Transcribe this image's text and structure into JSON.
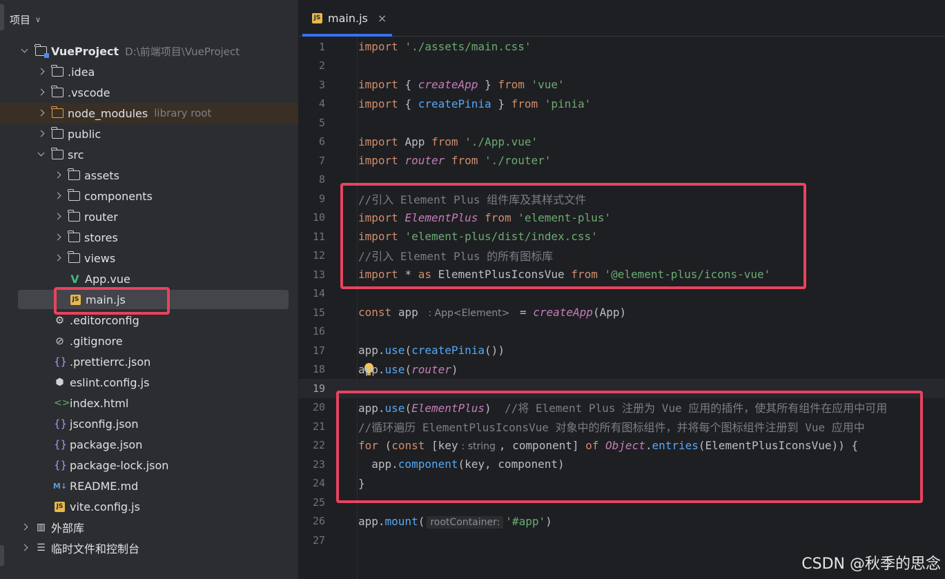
{
  "sidebar": {
    "header": {
      "title": "项目"
    },
    "project": {
      "name": "VueProject",
      "path": "D:\\前端项目\\VueProject"
    },
    "tree": [
      {
        "label": ".idea"
      },
      {
        "label": ".vscode"
      },
      {
        "label": "node_modules",
        "hint": "library root"
      },
      {
        "label": "public"
      },
      {
        "label": "src"
      },
      {
        "label": "assets"
      },
      {
        "label": "components"
      },
      {
        "label": "router"
      },
      {
        "label": "stores"
      },
      {
        "label": "views"
      },
      {
        "label": "App.vue"
      },
      {
        "label": "main.js"
      },
      {
        "label": ".editorconfig"
      },
      {
        "label": ".gitignore"
      },
      {
        "label": ".prettierrc.json"
      },
      {
        "label": "eslint.config.js"
      },
      {
        "label": "index.html"
      },
      {
        "label": "jsconfig.json"
      },
      {
        "label": "package.json"
      },
      {
        "label": "package-lock.json"
      },
      {
        "label": "README.md"
      },
      {
        "label": "vite.config.js"
      },
      {
        "label": "外部库"
      },
      {
        "label": "临时文件和控制台"
      }
    ],
    "icons": {
      "js_badge": "JS",
      "md_badge": "M↓"
    }
  },
  "editor": {
    "tab": {
      "label": "main.js",
      "close": "×"
    },
    "current_line": 19,
    "lines": {
      "l1": {
        "kw1": "import",
        "s1": "'./assets/main.css'"
      },
      "l3": {
        "kw1": "import",
        "p1": "{",
        "f1": "createApp",
        "p2": "}",
        "kw2": "from",
        "s1": "'vue'"
      },
      "l4": {
        "kw1": "import",
        "p1": "{",
        "f1": "createPinia",
        "p2": "}",
        "kw2": "from",
        "s1": "'pinia'"
      },
      "l6": {
        "kw1": "import",
        "t1": "App",
        "kw2": "from",
        "s1": "'./App.vue'"
      },
      "l7": {
        "kw1": "import",
        "f1": "router",
        "kw2": "from",
        "s1": "'./router'"
      },
      "l9": {
        "c1": "//引入 Element Plus 组件库及其样式文件"
      },
      "l10": {
        "kw1": "import",
        "f1": "ElementPlus",
        "kw2": "from",
        "s1": "'element-plus'"
      },
      "l11": {
        "kw1": "import",
        "s1": "'element-plus/dist/index.css'"
      },
      "l12": {
        "c1": "//引入 Element Plus 的所有图标库"
      },
      "l13": {
        "kw1": "import",
        "t1": "*",
        "kw2": "as",
        "t2": "ElementPlusIconsVue",
        "kw3": "from",
        "s1": "'@element-plus/icons-vue'"
      },
      "l15": {
        "kw1": "const",
        "t1": "app",
        "h1": ": App<Element>",
        "t2": "=",
        "f1": "createApp",
        "t3": "(App)"
      },
      "l17": {
        "t1": "app.",
        "f1": "use",
        "t2": "(",
        "f2": "createPinia",
        "t3": "())"
      },
      "l18": {
        "t1": "app.",
        "f1": "use",
        "t2": "(",
        "f2": "router",
        "t3": ")"
      },
      "l20": {
        "t1": "app.",
        "f1": "use",
        "t2": "(",
        "f2": "ElementPlus",
        "t3": ")",
        "c1": "//将 Element Plus 注册为 Vue 应用的插件，使其所有组件在应用中可用"
      },
      "l21": {
        "c1": "//循环遍历 ElementPlusIconsVue 对象中的所有图标组件，并将每个图标组件注册到 Vue 应用中"
      },
      "l22": {
        "kw1": "for",
        "t1": "(",
        "kw2": "const",
        "t2": "[key",
        "h1": ": string",
        "t3": ", component]",
        "kw3": "of",
        "f1": "Object",
        "t4": ".",
        "f2": "entries",
        "t5": "(ElementPlusIconsVue)) {"
      },
      "l23": {
        "t1": "app.",
        "f1": "component",
        "t2": "(key, component)"
      },
      "l24": {
        "t1": "}"
      },
      "l26": {
        "t1": "app.",
        "f1": "mount",
        "t2": "(",
        "h1": "rootContainer:",
        "s1": "'#app'",
        "t3": ")"
      }
    }
  },
  "watermark": "CSDN @秋季的思念",
  "colors": {
    "highlight_box": "#e8435f",
    "accent": "#3574f0"
  }
}
